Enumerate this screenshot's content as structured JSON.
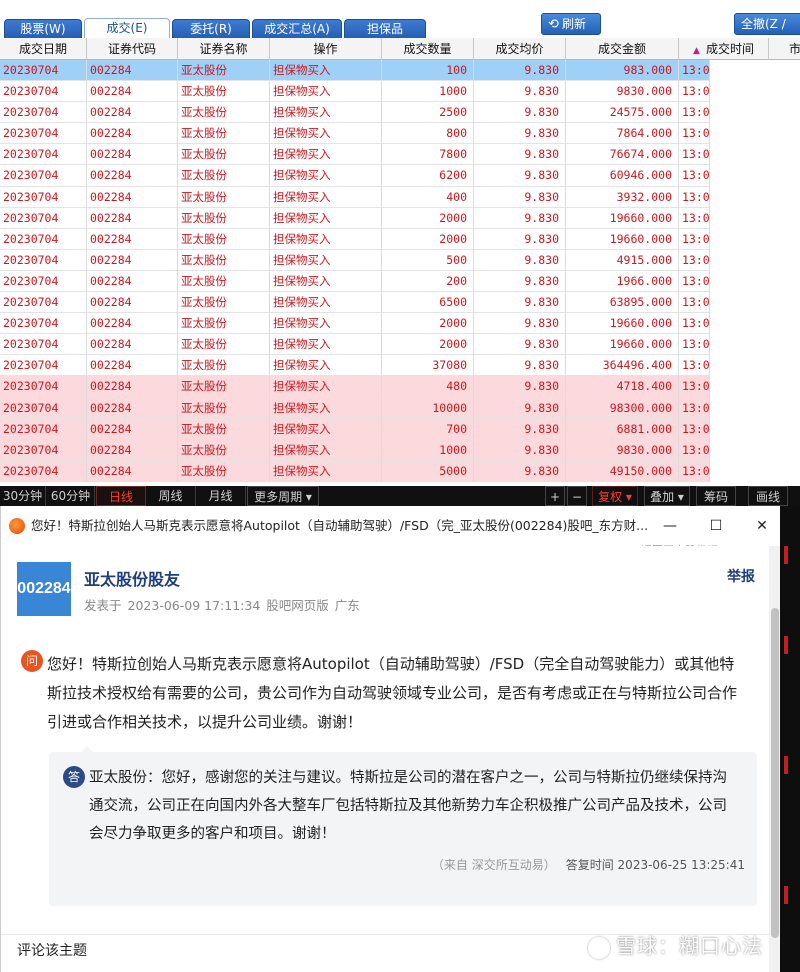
{
  "tabs": [
    "股票(W)",
    "成交(E)",
    "委托(R)",
    "成交汇总(A)",
    "担保品"
  ],
  "active_tab": 1,
  "toolbar": {
    "refresh": "刷新",
    "cancel_all": "全撤(Z /"
  },
  "columns": [
    "成交日期",
    "证券代码",
    "证券名称",
    "操作",
    "成交数量",
    "成交均价",
    "成交金额",
    "成交时间",
    "市"
  ],
  "rows": [
    {
      "date": "20230704",
      "code": "002284",
      "name": "亚太股份",
      "op": "担保物买入",
      "qty": "100",
      "price": "9.830",
      "amount": "983.000",
      "time": "13:0",
      "style": "sel"
    },
    {
      "date": "20230704",
      "code": "002284",
      "name": "亚太股份",
      "op": "担保物买入",
      "qty": "1000",
      "price": "9.830",
      "amount": "9830.000",
      "time": "13:0",
      "style": ""
    },
    {
      "date": "20230704",
      "code": "002284",
      "name": "亚太股份",
      "op": "担保物买入",
      "qty": "2500",
      "price": "9.830",
      "amount": "24575.000",
      "time": "13:0",
      "style": ""
    },
    {
      "date": "20230704",
      "code": "002284",
      "name": "亚太股份",
      "op": "担保物买入",
      "qty": "800",
      "price": "9.830",
      "amount": "7864.000",
      "time": "13:0",
      "style": ""
    },
    {
      "date": "20230704",
      "code": "002284",
      "name": "亚太股份",
      "op": "担保物买入",
      "qty": "7800",
      "price": "9.830",
      "amount": "76674.000",
      "time": "13:0",
      "style": ""
    },
    {
      "date": "20230704",
      "code": "002284",
      "name": "亚太股份",
      "op": "担保物买入",
      "qty": "6200",
      "price": "9.830",
      "amount": "60946.000",
      "time": "13:0",
      "style": ""
    },
    {
      "date": "20230704",
      "code": "002284",
      "name": "亚太股份",
      "op": "担保物买入",
      "qty": "400",
      "price": "9.830",
      "amount": "3932.000",
      "time": "13:0",
      "style": ""
    },
    {
      "date": "20230704",
      "code": "002284",
      "name": "亚太股份",
      "op": "担保物买入",
      "qty": "2000",
      "price": "9.830",
      "amount": "19660.000",
      "time": "13:0",
      "style": ""
    },
    {
      "date": "20230704",
      "code": "002284",
      "name": "亚太股份",
      "op": "担保物买入",
      "qty": "2000",
      "price": "9.830",
      "amount": "19660.000",
      "time": "13:0",
      "style": ""
    },
    {
      "date": "20230704",
      "code": "002284",
      "name": "亚太股份",
      "op": "担保物买入",
      "qty": "500",
      "price": "9.830",
      "amount": "4915.000",
      "time": "13:0",
      "style": ""
    },
    {
      "date": "20230704",
      "code": "002284",
      "name": "亚太股份",
      "op": "担保物买入",
      "qty": "200",
      "price": "9.830",
      "amount": "1966.000",
      "time": "13:0",
      "style": ""
    },
    {
      "date": "20230704",
      "code": "002284",
      "name": "亚太股份",
      "op": "担保物买入",
      "qty": "6500",
      "price": "9.830",
      "amount": "63895.000",
      "time": "13:0",
      "style": ""
    },
    {
      "date": "20230704",
      "code": "002284",
      "name": "亚太股份",
      "op": "担保物买入",
      "qty": "2000",
      "price": "9.830",
      "amount": "19660.000",
      "time": "13:0",
      "style": ""
    },
    {
      "date": "20230704",
      "code": "002284",
      "name": "亚太股份",
      "op": "担保物买入",
      "qty": "2000",
      "price": "9.830",
      "amount": "19660.000",
      "time": "13:0",
      "style": ""
    },
    {
      "date": "20230704",
      "code": "002284",
      "name": "亚太股份",
      "op": "担保物买入",
      "qty": "37080",
      "price": "9.830",
      "amount": "364496.400",
      "time": "13:0",
      "style": ""
    },
    {
      "date": "20230704",
      "code": "002284",
      "name": "亚太股份",
      "op": "担保物买入",
      "qty": "480",
      "price": "9.830",
      "amount": "4718.400",
      "time": "13:0",
      "style": "pink"
    },
    {
      "date": "20230704",
      "code": "002284",
      "name": "亚太股份",
      "op": "担保物买入",
      "qty": "10000",
      "price": "9.830",
      "amount": "98300.000",
      "time": "13:0",
      "style": "pink"
    },
    {
      "date": "20230704",
      "code": "002284",
      "name": "亚太股份",
      "op": "担保物买入",
      "qty": "700",
      "price": "9.830",
      "amount": "6881.000",
      "time": "13:0",
      "style": "pink"
    },
    {
      "date": "20230704",
      "code": "002284",
      "name": "亚太股份",
      "op": "担保物买入",
      "qty": "1000",
      "price": "9.830",
      "amount": "9830.000",
      "time": "13:0",
      "style": "pink"
    },
    {
      "date": "20230704",
      "code": "002284",
      "name": "亚太股份",
      "op": "担保物买入",
      "qty": "5000",
      "price": "9.830",
      "amount": "49150.000",
      "time": "13:0",
      "style": "pink"
    }
  ],
  "period_bar": {
    "items": [
      "30分钟",
      "60分钟",
      "日线",
      "周线",
      "月线",
      "更多周期 ▾"
    ],
    "active": "日线",
    "plus": "+",
    "minus": "−",
    "fuquan": "复权 ▾",
    "overlay": "叠加 ▾",
    "chip": "筹码",
    "draw": "画线"
  },
  "browser": {
    "title": "您好！特斯拉创始人马斯克表示愿意将Autopilot（自动辅助驾驶）/FSD（完_亚太股份(002284)股吧_东方财...",
    "subnav_text": "返回亚太股份吧 >",
    "min": "—",
    "max": "☐",
    "close": "✕"
  },
  "post": {
    "avatar_text": "002284",
    "author": "亚太股份股友",
    "report": "举报",
    "posted_prefix": "发表于",
    "posted_time": "2023-06-09 17:11:34",
    "source": "股吧网页版",
    "location": "广东",
    "q_icon": "问",
    "question": "您好！特斯拉创始人马斯克表示愿意将Autopilot（自动辅助驾驶）/FSD（完全自动驾驶能力）或其他特斯拉技术授权给有需要的公司，贵公司作为自动驾驶领域专业公司，是否有考虑或正在与特斯拉公司合作引进或合作相关技术，以提升公司业绩。谢谢！",
    "a_icon": "答",
    "answer": "亚太股份：您好，感谢您的关注与建议。特斯拉是公司的潜在客户之一，公司与特斯拉仍继续保持沟通交流，公司正在向国内外各大整车厂包括特斯拉及其他新势力车企积极推广公司产品及技术，公司会尽力争取更多的客户和项目。谢谢！",
    "answer_source": "（来自 深交所互动易）",
    "answer_time": "答复时间 2023-06-25 13:25:41",
    "comment_label": "评论该主题"
  },
  "watermark": "雪球：糊口心法",
  "colors": {
    "tab_blue": "#255fb3",
    "row_text": "#c8181e",
    "selected_row": "#9fd0f8",
    "pink_row": "#fcd9dc",
    "author_blue": "#1f3f7a"
  },
  "icons": [
    "refresh-icon",
    "sort-arrow-icon",
    "favicon-icon",
    "question-icon",
    "answer-icon",
    "xueqiu-logo-icon"
  ]
}
